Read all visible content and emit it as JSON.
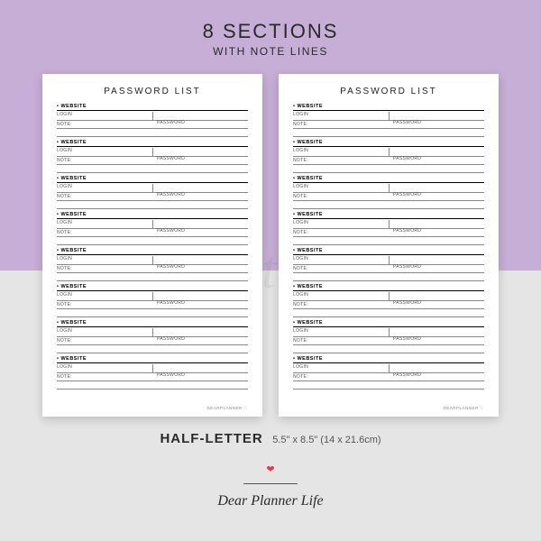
{
  "heading": {
    "main": "8 SECTIONS",
    "sub": "WITH NOTE LINES"
  },
  "page": {
    "title": "PASSWORD LIST",
    "section_count": 8,
    "labels": {
      "website": "WEBSITE",
      "login": "LOGIN",
      "password": "PASSWORD",
      "note": "NOTE:"
    },
    "footer": "DEARPLANNER ♡"
  },
  "watermark": "printable",
  "size": {
    "name": "HALF-LETTER",
    "detail": "5.5\" x 8.5\" (14 x 21.6cm)"
  },
  "brand": {
    "name": "Dear Planner Life"
  }
}
